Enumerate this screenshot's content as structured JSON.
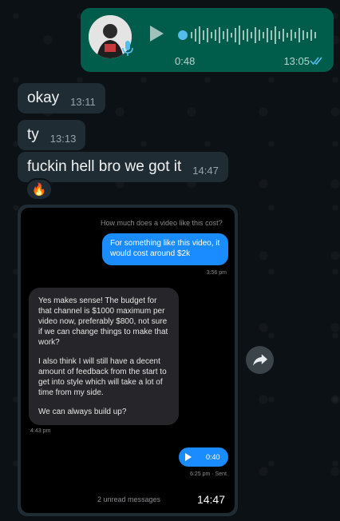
{
  "voice_note": {
    "duration": "0:48",
    "time": "13:05",
    "icons": [
      "avatar-photo",
      "mic-icon",
      "play-icon",
      "waveform",
      "double-check-icon"
    ],
    "accent": "#005c4b",
    "read_tick_color": "#53bdeb"
  },
  "messages": [
    {
      "text": "okay",
      "time": "13:11"
    },
    {
      "text": "ty",
      "time": "13:13"
    },
    {
      "text": "fuckin hell bro we got it",
      "time": "14:47"
    }
  ],
  "reaction": {
    "emoji": "🔥"
  },
  "image_message": {
    "time": "14:47",
    "screenshot": {
      "quoted": "How much does a video like this cost?",
      "outgoing_reply": "For something like this video, it would cost around $2k",
      "outgoing_time": "3:56 pm",
      "incoming_paragraphs": [
        "Yes makes sense! The budget for that channel is $1000 maximum per video now, preferably $800, not sure if we can change things to make that work?",
        "I also think I will still have a decent amount of feedback from the start to get into style which will take a lot of time from my side.",
        "We can always build up?"
      ],
      "incoming_time": "4:43 pm",
      "audio_duration": "0:40",
      "audio_sent": "6:25 pm · Sent",
      "unread": "2 unread messages"
    }
  },
  "forward_button": {
    "icon": "forward-arrow-icon"
  }
}
